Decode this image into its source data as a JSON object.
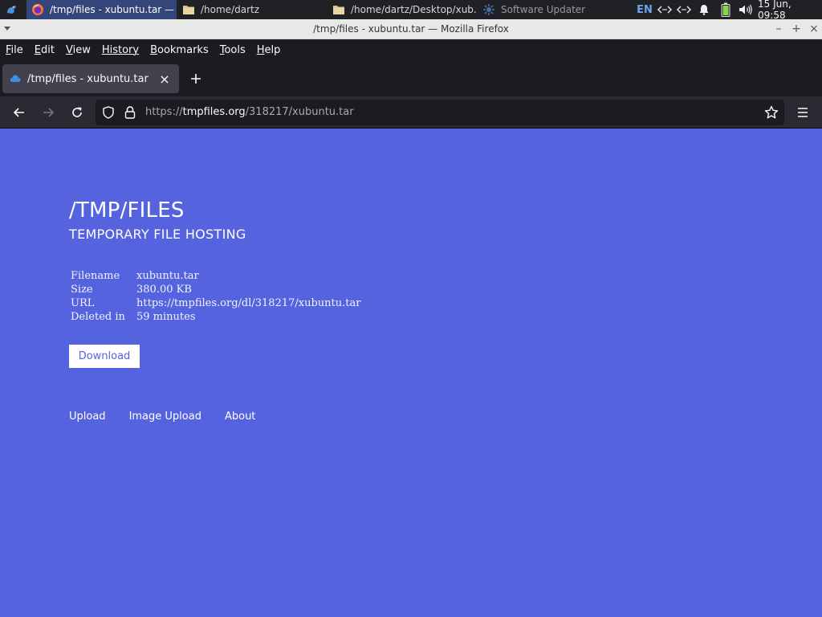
{
  "panel": {
    "tasks": [
      {
        "label": "/tmp/files - xubuntu.tar — ...",
        "icon": "firefox-icon",
        "active": true
      },
      {
        "label": "/home/dartz",
        "icon": "folder-icon",
        "active": false
      },
      {
        "label": "/home/dartz/Desktop/xub...",
        "icon": "folder-icon",
        "active": false
      },
      {
        "label": "Software Updater",
        "icon": "updater-icon",
        "active": false
      }
    ],
    "keyboard_layout": "EN",
    "clock": "15 Jun, 09:58"
  },
  "window": {
    "title": "/tmp/files - xubuntu.tar — Mozilla Firefox"
  },
  "menubar": {
    "items": [
      {
        "label": "File",
        "accel": "F",
        "rest": "ile"
      },
      {
        "label": "Edit",
        "accel": "E",
        "rest": "dit"
      },
      {
        "label": "View",
        "accel": "V",
        "rest": "iew"
      },
      {
        "label": "History",
        "accel": "",
        "rest": "History"
      },
      {
        "label": "Bookmarks",
        "accel": "B",
        "rest": "ookmarks"
      },
      {
        "label": "Tools",
        "accel": "T",
        "rest": "ools"
      },
      {
        "label": "Help",
        "accel": "H",
        "rest": "elp"
      }
    ]
  },
  "tabs": [
    {
      "title": "/tmp/files - xubuntu.tar"
    }
  ],
  "urlbar": {
    "scheme": "https://",
    "host": "tmpfiles.org",
    "path": "/318217/xubuntu.tar"
  },
  "page": {
    "title": "/TMP/FILES",
    "subtitle": "TEMPORARY FILE HOSTING",
    "info_rows": [
      {
        "key": "Filename",
        "value": "xubuntu.tar"
      },
      {
        "key": "Size",
        "value": "380.00 KB"
      },
      {
        "key": "URL",
        "value": "https://tmpfiles.org/dl/318217/xubuntu.tar"
      },
      {
        "key": "Deleted in",
        "value": "59 minutes"
      }
    ],
    "download_label": "Download",
    "footer_links": [
      "Upload",
      "Image Upload",
      "About"
    ]
  },
  "colors": {
    "page_background": "#5663df",
    "chrome_dark": "#1c1b22",
    "active_task": "#34457a"
  }
}
